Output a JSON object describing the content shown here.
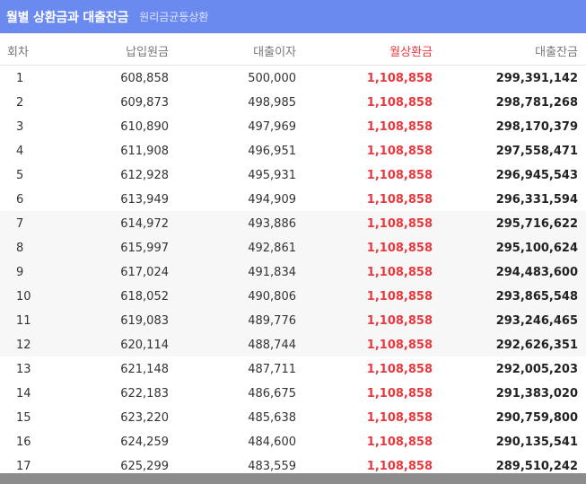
{
  "header": {
    "title": "월별 상환금과 대출잔금",
    "subtitle": "원리금균등상환"
  },
  "columns": {
    "no": "회차",
    "principal": "납입원금",
    "interest": "대출이자",
    "monthly": "월상환금",
    "balance": "대출잔금"
  },
  "rows": [
    {
      "no": "1",
      "principal": "608,858",
      "interest": "500,000",
      "monthly": "1,108,858",
      "balance": "299,391,142"
    },
    {
      "no": "2",
      "principal": "609,873",
      "interest": "498,985",
      "monthly": "1,108,858",
      "balance": "298,781,268"
    },
    {
      "no": "3",
      "principal": "610,890",
      "interest": "497,969",
      "monthly": "1,108,858",
      "balance": "298,170,379"
    },
    {
      "no": "4",
      "principal": "611,908",
      "interest": "496,951",
      "monthly": "1,108,858",
      "balance": "297,558,471"
    },
    {
      "no": "5",
      "principal": "612,928",
      "interest": "495,931",
      "monthly": "1,108,858",
      "balance": "296,945,543"
    },
    {
      "no": "6",
      "principal": "613,949",
      "interest": "494,909",
      "monthly": "1,108,858",
      "balance": "296,331,594"
    },
    {
      "no": "7",
      "principal": "614,972",
      "interest": "493,886",
      "monthly": "1,108,858",
      "balance": "295,716,622"
    },
    {
      "no": "8",
      "principal": "615,997",
      "interest": "492,861",
      "monthly": "1,108,858",
      "balance": "295,100,624"
    },
    {
      "no": "9",
      "principal": "617,024",
      "interest": "491,834",
      "monthly": "1,108,858",
      "balance": "294,483,600"
    },
    {
      "no": "10",
      "principal": "618,052",
      "interest": "490,806",
      "monthly": "1,108,858",
      "balance": "293,865,548"
    },
    {
      "no": "11",
      "principal": "619,083",
      "interest": "489,776",
      "monthly": "1,108,858",
      "balance": "293,246,465"
    },
    {
      "no": "12",
      "principal": "620,114",
      "interest": "488,744",
      "monthly": "1,108,858",
      "balance": "292,626,351"
    },
    {
      "no": "13",
      "principal": "621,148",
      "interest": "487,711",
      "monthly": "1,108,858",
      "balance": "292,005,203"
    },
    {
      "no": "14",
      "principal": "622,183",
      "interest": "486,675",
      "monthly": "1,108,858",
      "balance": "291,383,020"
    },
    {
      "no": "15",
      "principal": "623,220",
      "interest": "485,638",
      "monthly": "1,108,858",
      "balance": "290,759,800"
    },
    {
      "no": "16",
      "principal": "624,259",
      "interest": "484,600",
      "monthly": "1,108,858",
      "balance": "290,135,541"
    },
    {
      "no": "17",
      "principal": "625,299",
      "interest": "483,559",
      "monthly": "1,108,858",
      "balance": "289,510,242"
    }
  ]
}
